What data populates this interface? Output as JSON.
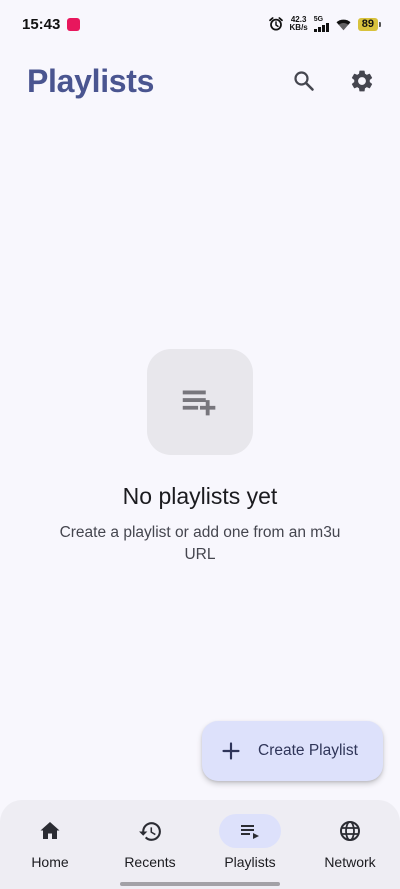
{
  "status_bar": {
    "time": "15:43",
    "net_speed_value": "42.3",
    "net_speed_unit": "KB/s",
    "network_type": "5G",
    "battery": "89"
  },
  "header": {
    "title": "Playlists"
  },
  "empty_state": {
    "title": "No playlists yet",
    "subtitle": "Create a playlist or add one from an m3u URL"
  },
  "fab": {
    "label": "Create Playlist"
  },
  "bottom_nav": {
    "items": [
      {
        "label": "Home",
        "icon": "home-icon"
      },
      {
        "label": "Recents",
        "icon": "history-icon"
      },
      {
        "label": "Playlists",
        "icon": "playlist-play-icon",
        "active": true
      },
      {
        "label": "Network",
        "icon": "globe-icon"
      }
    ]
  },
  "colors": {
    "title": "#4a5590",
    "fab_bg": "#dde1fb",
    "background": "#f8f7fd",
    "nav_bg": "#eeedf3"
  }
}
